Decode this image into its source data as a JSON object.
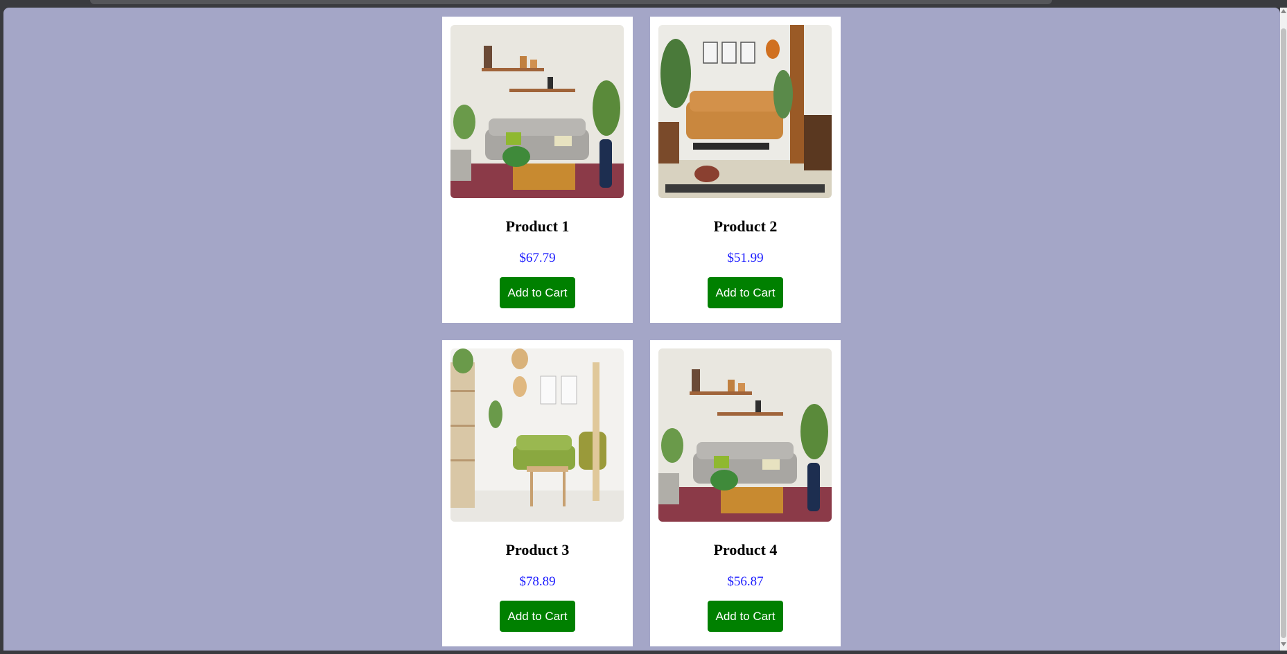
{
  "products": [
    {
      "name": "Product 1",
      "price": "$67.79",
      "button_label": "Add to Cart",
      "image_icon": "living-room-photo-icon"
    },
    {
      "name": "Product 2",
      "price": "$51.99",
      "button_label": "Add to Cart",
      "image_icon": "living-room-photo-icon"
    },
    {
      "name": "Product 3",
      "price": "$78.89",
      "button_label": "Add to Cart",
      "image_icon": "living-room-photo-icon"
    },
    {
      "name": "Product 4",
      "price": "$56.87",
      "button_label": "Add to Cart",
      "image_icon": "living-room-photo-icon"
    }
  ],
  "colors": {
    "page_background": "#a4a6c7",
    "card_background": "#ffffff",
    "button": "#008000",
    "price": "#1a1aff"
  }
}
